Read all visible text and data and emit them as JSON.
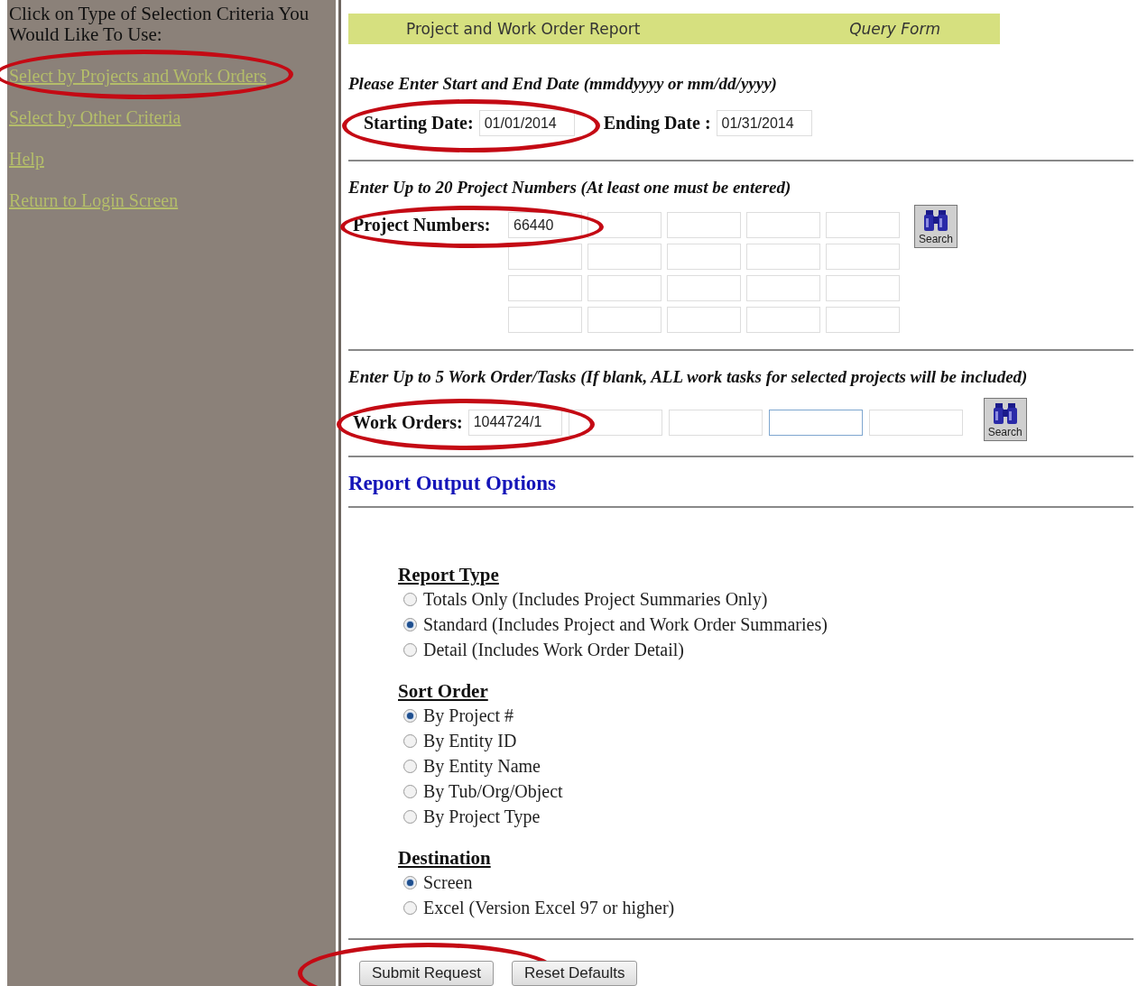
{
  "sidebar": {
    "intro": "Click on Type of Selection Criteria You Would Like To Use:",
    "links": [
      {
        "label": "Select by Projects and Work Orders",
        "circled": true
      },
      {
        "label": "Select by Other Criteria"
      },
      {
        "label": "Help"
      },
      {
        "label": "Return to Login Screen"
      }
    ]
  },
  "header": {
    "title": "Project and Work Order Report",
    "subtitle": "Query Form"
  },
  "dates": {
    "prompt": "Please Enter Start and End Date (mmddyyyy or mm/dd/yyyy)",
    "start": {
      "label": "Starting Date:",
      "value": "01/01/2014",
      "circled": true
    },
    "end": {
      "label": "Ending Date :",
      "value": "01/31/2014"
    }
  },
  "projects": {
    "prompt": "Enter Up to 20 Project Numbers (At least one must be entered)",
    "label": "Project Numbers:",
    "circled": true,
    "search_label": "Search",
    "values": [
      "66440"
    ]
  },
  "work_orders": {
    "prompt": "Enter Up to 5 Work Order/Tasks (If blank, ALL work tasks for selected projects will be included)",
    "label": "Work Orders:",
    "circled": true,
    "search_label": "Search",
    "fields": [
      {
        "value": "1044724/1",
        "focused": false
      },
      {
        "focused": false
      },
      {
        "focused": false
      },
      {
        "focused": true
      },
      {
        "focused": false
      }
    ]
  },
  "output": {
    "title": "Report Output Options",
    "groups": [
      {
        "title": "Report Type",
        "options": [
          {
            "label": "Totals Only (Includes Project Summaries Only)",
            "selected": false
          },
          {
            "label": "Standard (Includes Project and Work Order Summaries)",
            "selected": true
          },
          {
            "label": "Detail (Includes Work Order Detail)",
            "selected": false
          }
        ]
      },
      {
        "title": "Sort Order",
        "options": [
          {
            "label": "By Project #",
            "selected": true
          },
          {
            "label": "By Entity ID",
            "selected": false
          },
          {
            "label": "By Entity Name",
            "selected": false
          },
          {
            "label": "By Tub/Org/Object",
            "selected": false
          },
          {
            "label": "By Project Type",
            "selected": false
          }
        ]
      },
      {
        "title": "Destination",
        "options": [
          {
            "label": "Screen",
            "selected": true
          },
          {
            "label": "Excel (Version Excel 97 or higher)",
            "selected": false
          }
        ]
      }
    ]
  },
  "buttons": [
    {
      "label": "Submit Request",
      "circled": true
    },
    {
      "label": "Reset Defaults"
    }
  ]
}
